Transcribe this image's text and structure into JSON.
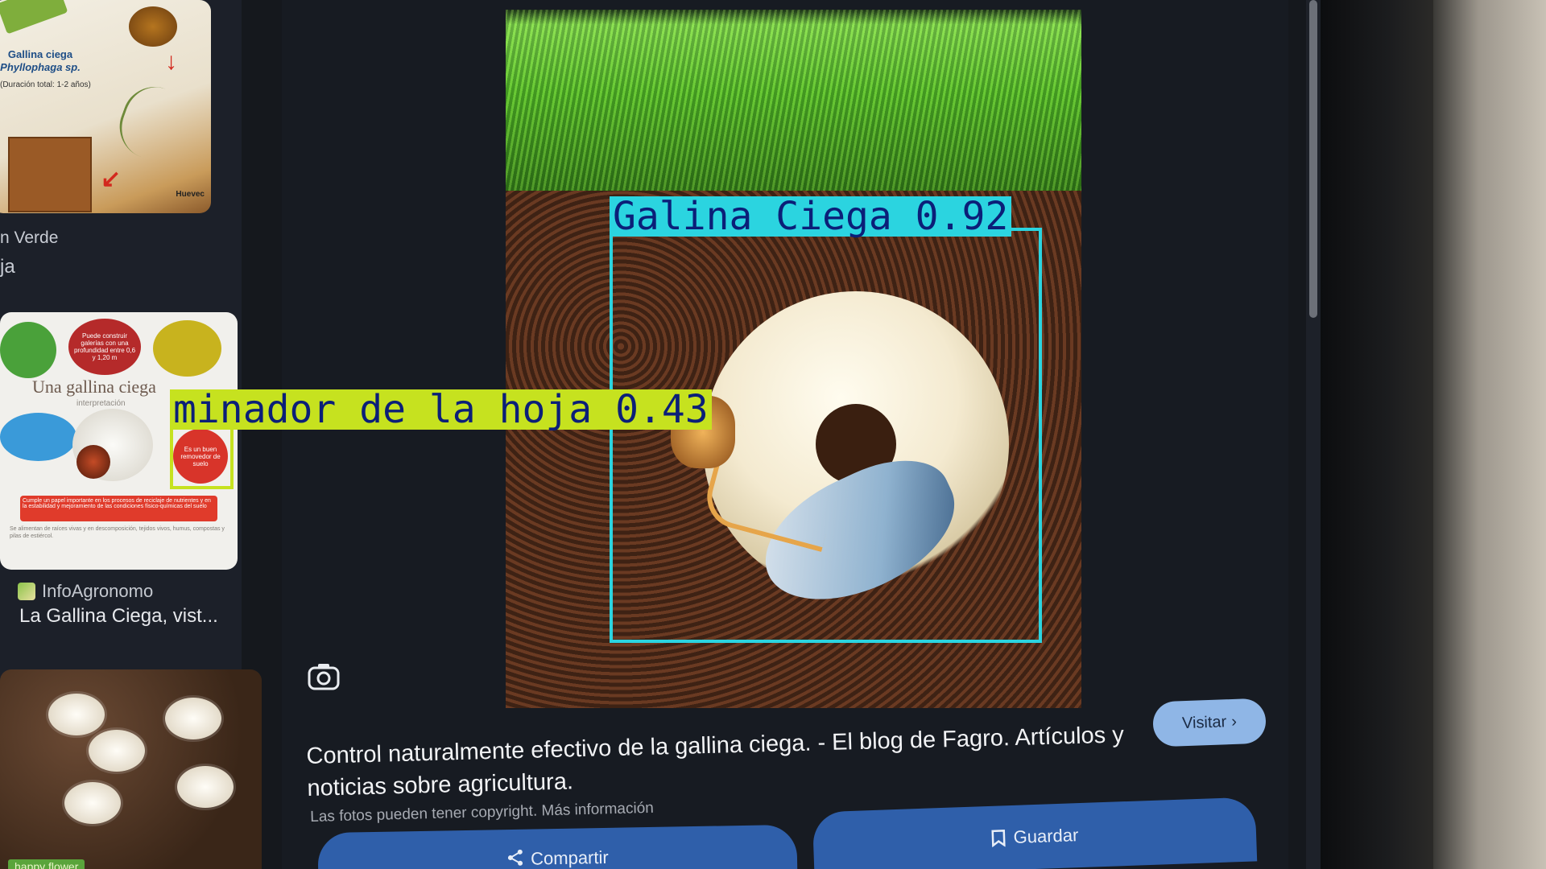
{
  "left_results": {
    "card1": {
      "title_line1": "Gallina ciega",
      "title_line2": "Phyllophaga sp.",
      "duration": "(Duración total: 1-2 años)",
      "corner_text": "Huevec"
    },
    "caption_line1": "n Verde",
    "caption_line2": "ja",
    "card2": {
      "title": "Una gallina ciega",
      "subtitle": "interpretación",
      "bubble1": "Puede construir galerías con una profundidad entre 0,6 y 1,20 m",
      "bubble2": "Es un buen removedor de suelo",
      "redbar": "Cumple un papel importante en los procesos de reciclaje de nutrientes y en la estabilidad y mejoramiento de las condiciones físico-químicas del suelo",
      "small": "Se alimentan de raíces vivas y en descomposición, tejidos vivos, humus, compostas y pilas de estiércol."
    },
    "source_name": "InfoAgronomo",
    "source_title": "La Gallina Ciega, vist...",
    "card3_badge": "happy flower"
  },
  "detections": [
    {
      "label": "Galina Ciega 0.92",
      "color": "#2bd4e0",
      "label_text_color": "#0b1f78"
    },
    {
      "label": "minador de la hoja 0.43",
      "color": "#c6e21f",
      "label_text_color": "#0b1f78"
    }
  ],
  "preview": {
    "title": "Control naturalmente efectivo de la gallina ciega. - El blog de Fagro. Artículos y noticias sobre agricultura.",
    "copyright": "Las fotos pueden tener copyright. Más información",
    "visit_label": "Visitar",
    "save_label": "Guardar",
    "share_label": "Compartir"
  },
  "icons": {
    "lens": "camera-lens-icon",
    "visit": "chevron-right-icon",
    "save": "bookmark-icon",
    "share": "share-icon"
  },
  "colors": {
    "accent_button": "#2f5faa",
    "visit_button": "#8fb6e6",
    "background": "#171b22"
  }
}
